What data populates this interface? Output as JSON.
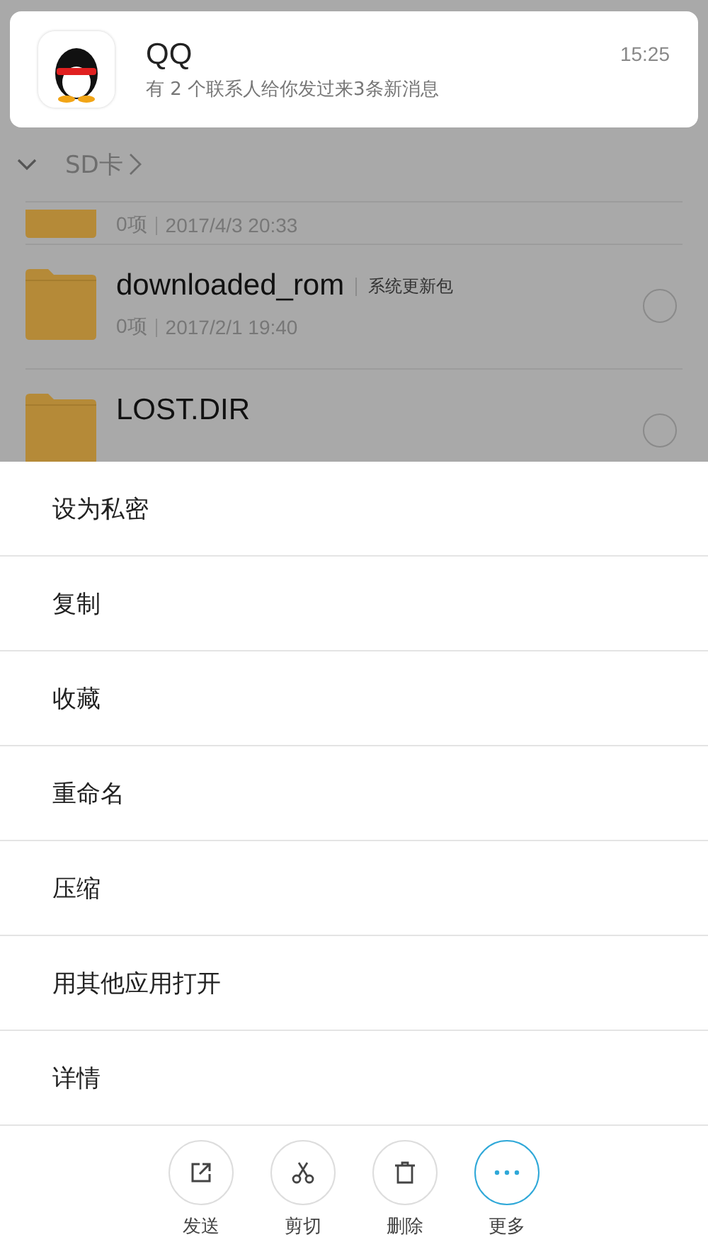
{
  "notification": {
    "app": "QQ",
    "message": "有 2 个联系人给你发过来3条新消息",
    "time": "15:25"
  },
  "breadcrumb": {
    "path": "SD卡"
  },
  "files": [
    {
      "kind": "partial",
      "count": "0项",
      "date": "2017/4/3 20:33"
    },
    {
      "kind": "full",
      "name": "downloaded_rom",
      "tag": "系统更新包",
      "count": "0项",
      "date": "2017/2/1 19:40",
      "checked": false
    },
    {
      "kind": "full",
      "name": "LOST.DIR",
      "checked": false
    }
  ],
  "menu": [
    "设为私密",
    "复制",
    "收藏",
    "重命名",
    "压缩",
    "用其他应用打开",
    "详情"
  ],
  "actions": [
    {
      "kind": "share",
      "label": "发送",
      "selected": false
    },
    {
      "kind": "cut",
      "label": "剪切",
      "selected": false
    },
    {
      "kind": "delete",
      "label": "删除",
      "selected": false
    },
    {
      "kind": "more",
      "label": "更多",
      "selected": true
    }
  ]
}
